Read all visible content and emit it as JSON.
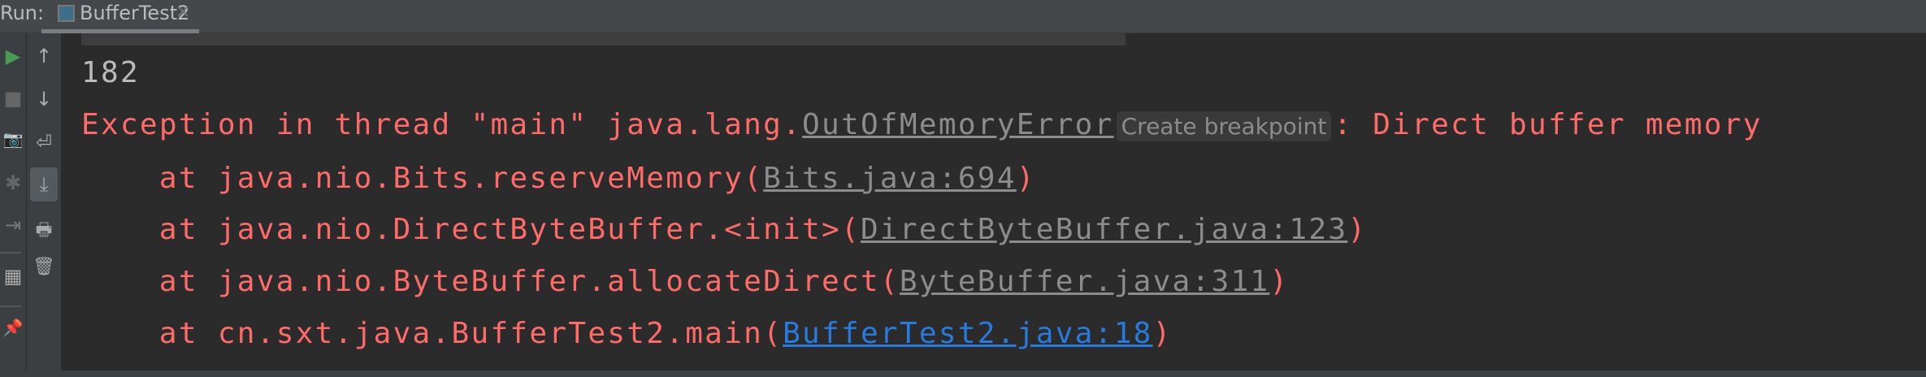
{
  "header": {
    "run_label": "Run:",
    "tab": {
      "label": "BufferTest2",
      "close": "×"
    }
  },
  "toolbar": {
    "left": [
      {
        "icon": "run-icon",
        "glyph": "▶",
        "color": "#499c54"
      },
      {
        "icon": "stop-icon",
        "glyph": "■"
      },
      {
        "icon": "camera-icon",
        "glyph": "📷"
      },
      {
        "icon": "debug-icon",
        "glyph": "✱"
      },
      {
        "icon": "exit-icon",
        "glyph": "⇥"
      },
      {
        "icon": "layout-icon",
        "glyph": "▦"
      },
      {
        "icon": "pin-icon",
        "glyph": "📌"
      }
    ],
    "right": [
      {
        "icon": "arrow-up-icon",
        "glyph": "↑"
      },
      {
        "icon": "arrow-down-icon",
        "glyph": "↓"
      },
      {
        "icon": "soft-wrap-icon",
        "glyph": "⏎"
      },
      {
        "icon": "scroll-to-end-icon",
        "glyph": "⤓"
      },
      {
        "icon": "print-icon",
        "glyph": "🖶"
      },
      {
        "icon": "trash-icon",
        "glyph": "🗑"
      }
    ]
  },
  "console": {
    "output": "182",
    "exception_prefix": "Exception in thread \"main\" java.lang.",
    "exception_class": "OutOfMemoryError",
    "inlay_hint": "Create breakpoint",
    "exception_message": ": Direct buffer memory",
    "stack": [
      {
        "prefix": "    at java.nio.Bits.reserveMemory(",
        "link": "Bits.java:694",
        "suffix": ")"
      },
      {
        "prefix": "    at java.nio.DirectByteBuffer.<init>(",
        "link": "DirectByteBuffer.java:123",
        "suffix": ")"
      },
      {
        "prefix": "    at java.nio.ByteBuffer.allocateDirect(",
        "link": "ByteBuffer.java:311",
        "suffix": ")"
      },
      {
        "prefix": "    at cn.sxt.java.BufferTest2.main(",
        "link": "BufferTest2.java:18",
        "suffix": ")"
      }
    ]
  },
  "colors": {
    "error": "#ff6b68",
    "link_user": "#287bde",
    "link_lib": "#8c8c8c",
    "background": "#2b2b2b"
  }
}
